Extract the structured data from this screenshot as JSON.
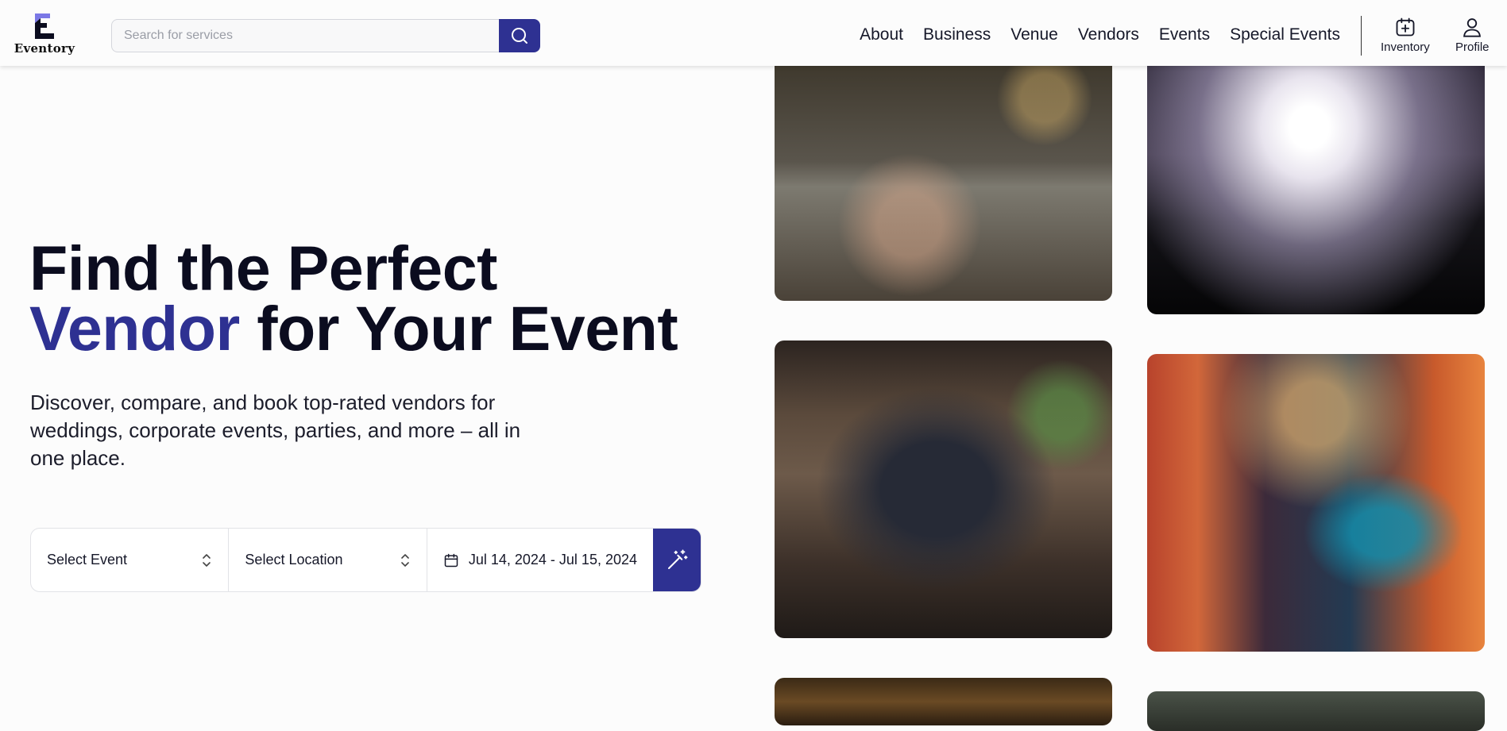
{
  "brand": {
    "name": "Eventory",
    "accent_color": "#2e3192",
    "logo_icon": "eventory-logo-icon"
  },
  "header": {
    "search": {
      "placeholder": "Search for services",
      "value": "",
      "button_icon": "search-icon"
    },
    "nav": [
      {
        "label": "About"
      },
      {
        "label": "Business"
      },
      {
        "label": "Venue"
      },
      {
        "label": "Vendors"
      },
      {
        "label": "Events"
      },
      {
        "label": "Special Events"
      }
    ],
    "inventory": {
      "label": "Inventory",
      "icon": "calendar-plus-icon"
    },
    "profile": {
      "label": "Profile",
      "icon": "user-icon"
    }
  },
  "hero": {
    "title_line1": "Find the Perfect",
    "title_accent": "Vendor",
    "title_rest": " for Your Event",
    "description": "Discover, compare, and book top-rated vendors for weddings, corporate events, parties, and more – all in one place."
  },
  "filters": {
    "event_select": {
      "value": "Select Event",
      "icon": "chevron-up-down-icon"
    },
    "location_select": {
      "value": "Select Location",
      "icon": "chevron-up-down-icon"
    },
    "date_range": {
      "value": "Jul 14, 2024 - Jul 15, 2024",
      "icon": "calendar-icon"
    },
    "submit_icon": "magic-wand-icon"
  },
  "gallery": [
    {
      "name": "party-celebration-photo"
    },
    {
      "name": "concert-crowd-photo"
    },
    {
      "name": "speaker-conference-photo"
    },
    {
      "name": "festival-lights-photo"
    },
    {
      "name": "dinner-event-photo"
    },
    {
      "name": "outdoor-event-photo"
    }
  ]
}
